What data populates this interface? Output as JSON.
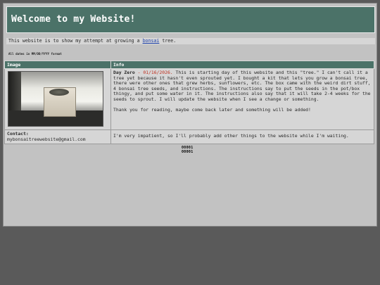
{
  "header": {
    "title": "Welcome to my Website!"
  },
  "intro": {
    "before": "This website is to show my attempt at growing a ",
    "link": "bonsai",
    "after": " tree."
  },
  "note": "All dates in MM/DD/YYYY format",
  "table": {
    "headers": {
      "image": "Image",
      "info": "Info"
    },
    "row1": {
      "title": "Day Zero",
      "date": " - 01/16/2026.",
      "body": " This is starting day of this website and this \"tree.\" I can't call it a tree yet because it hasn't even sprouted yet. I bought a kit that lets you grow a bonsai tree, there were other ones that grew herbs, sunflowers, etc. The box came with the weird dirt stuff, 4 bonsai tree seeds, and instructions. The instructions say to put the seeds in the pot/box thingy, and put some water in it. The instructions also say that it will take 2-4 weeks for the seeds to sprout. I will update the website when I see a change or something.",
      "closing": "Thank you for reading, maybe come back later and something will be added!"
    },
    "row2": {
      "contact_label": "Contact:",
      "email": "mybonsaitreewebsite@gmail.com",
      "info": "I'm very impatient, so I'll probably add other things to the website while I'm waiting."
    }
  },
  "counter": {
    "line1": "00001",
    "line2": "00001"
  }
}
